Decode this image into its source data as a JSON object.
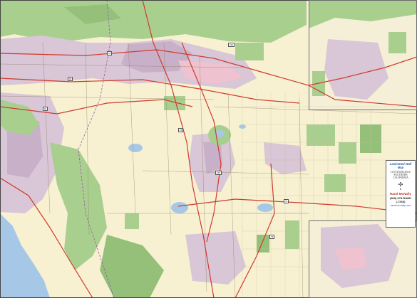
{
  "map": {
    "colors": {
      "land": "#f7f1d2",
      "urban": "#d9c6d6",
      "urban_dense": "#c9b0c9",
      "parks": "#a9cf8f",
      "forest": "#94c07a",
      "water": "#a6c8e6",
      "highway": "#cf3b2c",
      "road": "#7d6b5a",
      "pink_zone": "#efc2cf"
    },
    "legend": {
      "brand": "Laminated Wall Map",
      "title": "LOS ANGELES & SOUTHERN CALIFORNIA",
      "compass": "N",
      "maker": "Rand McNally",
      "phone_line1": "(800) 678-RAND",
      "phone_line2": "(-7263)",
      "website": "randmcnally.com"
    },
    "insets": [
      "upper-right",
      "lower-right"
    ],
    "route_shields": [
      "10",
      "15",
      "60",
      "91",
      "215",
      "210",
      "74",
      "79"
    ]
  }
}
